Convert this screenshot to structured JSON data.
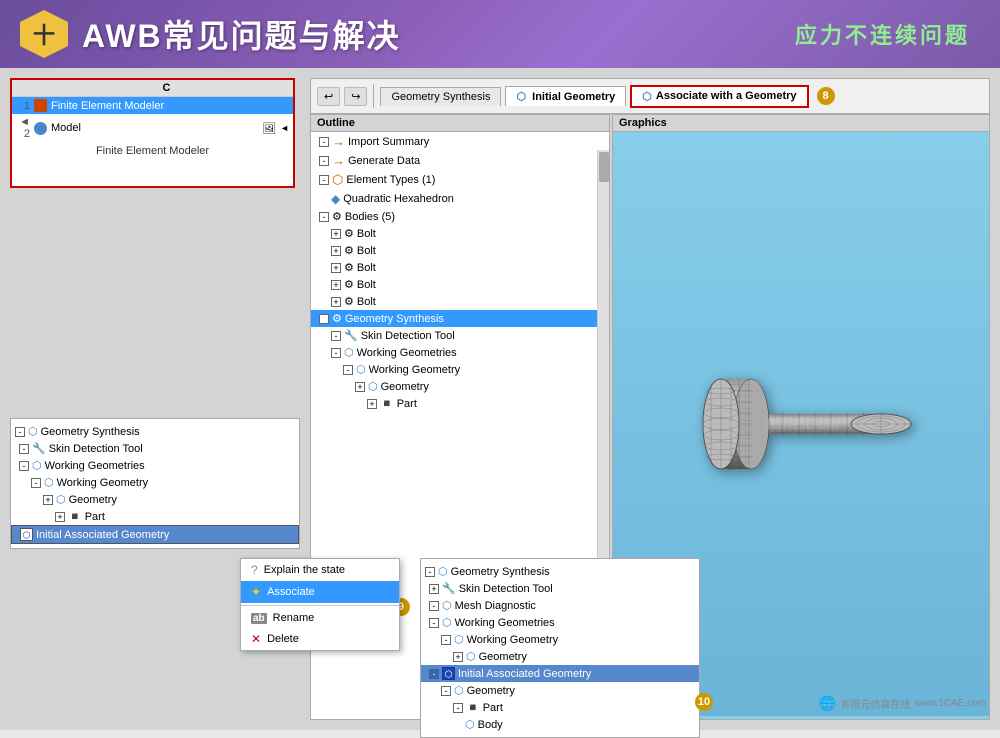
{
  "header": {
    "icon": "十",
    "title": "AWB常见问题与解决",
    "subtitle": "应力不连续问题"
  },
  "toolbar": {
    "undo_label": "↩",
    "redo_label": "↪",
    "tabs": [
      "Geometry Synthesis",
      "Initial Geometry",
      "Associate with a Geometry"
    ],
    "badge_8": "8"
  },
  "outline_panel": {
    "title": "Outline",
    "items": [
      {
        "label": "Import Summary",
        "indent": 1
      },
      {
        "label": "Generate Data",
        "indent": 1
      },
      {
        "label": "Element Types (1)",
        "indent": 1
      },
      {
        "label": "Quadratic Hexahedron",
        "indent": 2
      },
      {
        "label": "Bodies (5)",
        "indent": 1
      },
      {
        "label": "Bolt",
        "indent": 2
      },
      {
        "label": "Bolt",
        "indent": 2
      },
      {
        "label": "Bolt",
        "indent": 2
      },
      {
        "label": "Bolt",
        "indent": 2
      },
      {
        "label": "Bolt",
        "indent": 2
      },
      {
        "label": "Geometry Synthesis",
        "indent": 1,
        "selected": true
      },
      {
        "label": "Skin Detection Tool",
        "indent": 2
      },
      {
        "label": "Working Geometries",
        "indent": 2
      },
      {
        "label": "Working Geometry",
        "indent": 3
      },
      {
        "label": "Geometry",
        "indent": 4
      },
      {
        "label": "Part",
        "indent": 5
      }
    ]
  },
  "graphics_panel": {
    "title": "Graphics"
  },
  "fem_panel": {
    "col_c": "C",
    "rows": [
      {
        "num": "1",
        "label": "Finite Element Modeler",
        "selected": true
      },
      {
        "num": "2",
        "label": "Model",
        "selected": false
      }
    ],
    "caption": "Finite Element Modeler"
  },
  "geo_tree": {
    "items": [
      {
        "label": "Geometry Synthesis",
        "indent": 0
      },
      {
        "label": "Skin Detection Tool",
        "indent": 1
      },
      {
        "label": "Working Geometries",
        "indent": 1
      },
      {
        "label": "Working Geometry",
        "indent": 2
      },
      {
        "label": "Geometry",
        "indent": 3
      },
      {
        "label": "Part",
        "indent": 4
      },
      {
        "label": "Initial Associated Geometry",
        "indent": 1,
        "selected": true
      }
    ]
  },
  "context_menu": {
    "items": [
      {
        "label": "Explain the state",
        "icon": "?"
      },
      {
        "label": "Associate",
        "icon": "✦",
        "selected": true
      },
      {
        "label": "Rename",
        "icon": "ab"
      },
      {
        "label": "Delete",
        "icon": "✕"
      }
    ],
    "badge_9": "9"
  },
  "bottom_tree": {
    "badge_10": "10",
    "items": [
      {
        "label": "Geometry Synthesis",
        "indent": 0
      },
      {
        "label": "Skin Detection Tool",
        "indent": 1
      },
      {
        "label": "Mesh Diagnostic",
        "indent": 1
      },
      {
        "label": "Working Geometries",
        "indent": 1
      },
      {
        "label": "Working Geometry",
        "indent": 2
      },
      {
        "label": "Geometry",
        "indent": 3
      },
      {
        "label": "Initial Associated Geometry",
        "indent": 1,
        "selected": true
      },
      {
        "label": "Geometry",
        "indent": 2
      },
      {
        "label": "Part",
        "indent": 3
      },
      {
        "label": "Body",
        "indent": 4
      }
    ]
  },
  "watermark": {
    "text": "有限元仿真在线",
    "url": "www.1CAE.com"
  }
}
